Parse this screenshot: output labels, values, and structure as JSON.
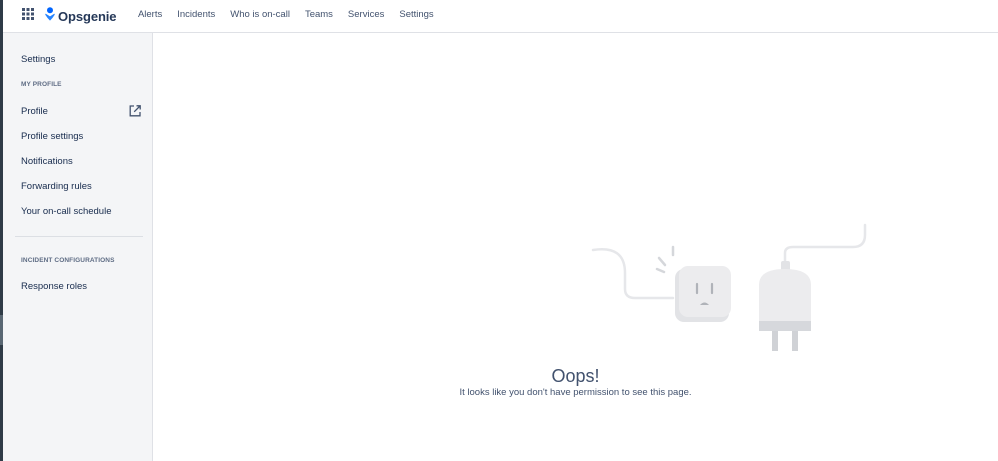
{
  "brand": {
    "name": "Opsgenie",
    "color": "#0052cc"
  },
  "nav": {
    "items": [
      "Alerts",
      "Incidents",
      "Who is on-call",
      "Teams",
      "Services",
      "Settings"
    ]
  },
  "sidebar": {
    "title": "Settings",
    "sections": [
      {
        "heading": "MY PROFILE",
        "items": [
          "Profile",
          "Profile settings",
          "Notifications",
          "Forwarding rules",
          "Your on-call schedule"
        ]
      },
      {
        "heading": "INCIDENT CONFIGURATIONS",
        "items": [
          "Response roles"
        ]
      }
    ],
    "profile_icon": "external-link-icon"
  },
  "empty_state": {
    "title": "Oops!",
    "message": "It looks like you don't have permission to see this page.",
    "illustration": "unplugged-socket-icon"
  },
  "colors": {
    "sidebar_bg": "#f4f5f7",
    "text": "#172b4d",
    "muted": "#5e6c84"
  }
}
